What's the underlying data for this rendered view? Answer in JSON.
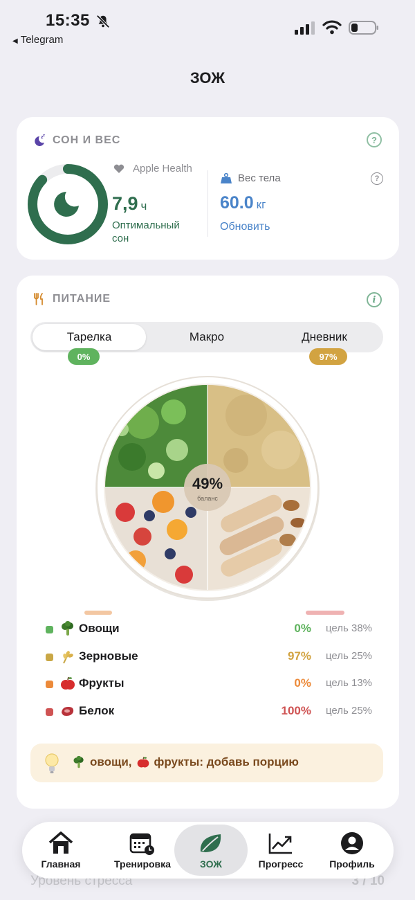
{
  "status": {
    "time": "15:35",
    "back_app": "Telegram"
  },
  "page_title": "ЗОЖ",
  "sleep_card": {
    "title": "СОН И ВЕС",
    "help": "?",
    "source": "Apple Health",
    "hours": "7,9",
    "hours_unit": "ч",
    "sleep_status": "Оптимальный сон",
    "sleep_progress_fraction": 0.87,
    "weight_label": "Вес тела",
    "weight_value": "60.0",
    "weight_unit": "кг",
    "update_link": "Обновить"
  },
  "nutrition": {
    "title": "ПИТАНИЕ",
    "info": "i",
    "tabs": [
      {
        "label": "Тарелка",
        "active": true
      },
      {
        "label": "Макро",
        "active": false
      },
      {
        "label": "Дневник",
        "active": false
      }
    ],
    "badges": [
      {
        "text": "0%",
        "color": "#5fb35e"
      },
      {
        "text": "97%",
        "color": "#d2a341"
      }
    ],
    "plate_center_value": "49%",
    "plate_center_label": "баланс",
    "rows": [
      {
        "dot": "#5fb35e",
        "icon": "broccoli-icon",
        "name": "Овощи",
        "pct": "0%",
        "pct_color": "#5fb35e",
        "goal": "цель 38%"
      },
      {
        "dot": "#c9a746",
        "icon": "wheat-icon",
        "name": "Зерновые",
        "pct": "97%",
        "pct_color": "#d2a341",
        "goal": "цель 25%"
      },
      {
        "dot": "#ec8a3a",
        "icon": "apple-icon",
        "name": "Фрукты",
        "pct": "0%",
        "pct_color": "#ec8a3a",
        "goal": "цель 13%"
      },
      {
        "dot": "#cf5353",
        "icon": "meat-icon",
        "name": "Белок",
        "pct": "100%",
        "pct_color": "#cf5353",
        "goal": "цель 25%"
      }
    ],
    "hint_text": "овощи, фрукты: добавь порцию",
    "hint_part1": "овощи,",
    "hint_part2": "фрукты: добавь порцию"
  },
  "behind_nav": {
    "label": "Уровень стресса",
    "value": "3 / 10"
  },
  "tabbar": [
    {
      "label": "Главная",
      "icon": "home-icon",
      "active": false
    },
    {
      "label": "Тренировка",
      "icon": "calendar-clock-icon",
      "active": false
    },
    {
      "label": "ЗОЖ",
      "icon": "leaf-icon",
      "active": true
    },
    {
      "label": "Прогресс",
      "icon": "chart-up-icon",
      "active": false
    },
    {
      "label": "Профиль",
      "icon": "profile-icon",
      "active": false
    }
  ],
  "colors": {
    "green": "#2f6e4e",
    "blue": "#4a84c9",
    "background": "#efeef4"
  }
}
